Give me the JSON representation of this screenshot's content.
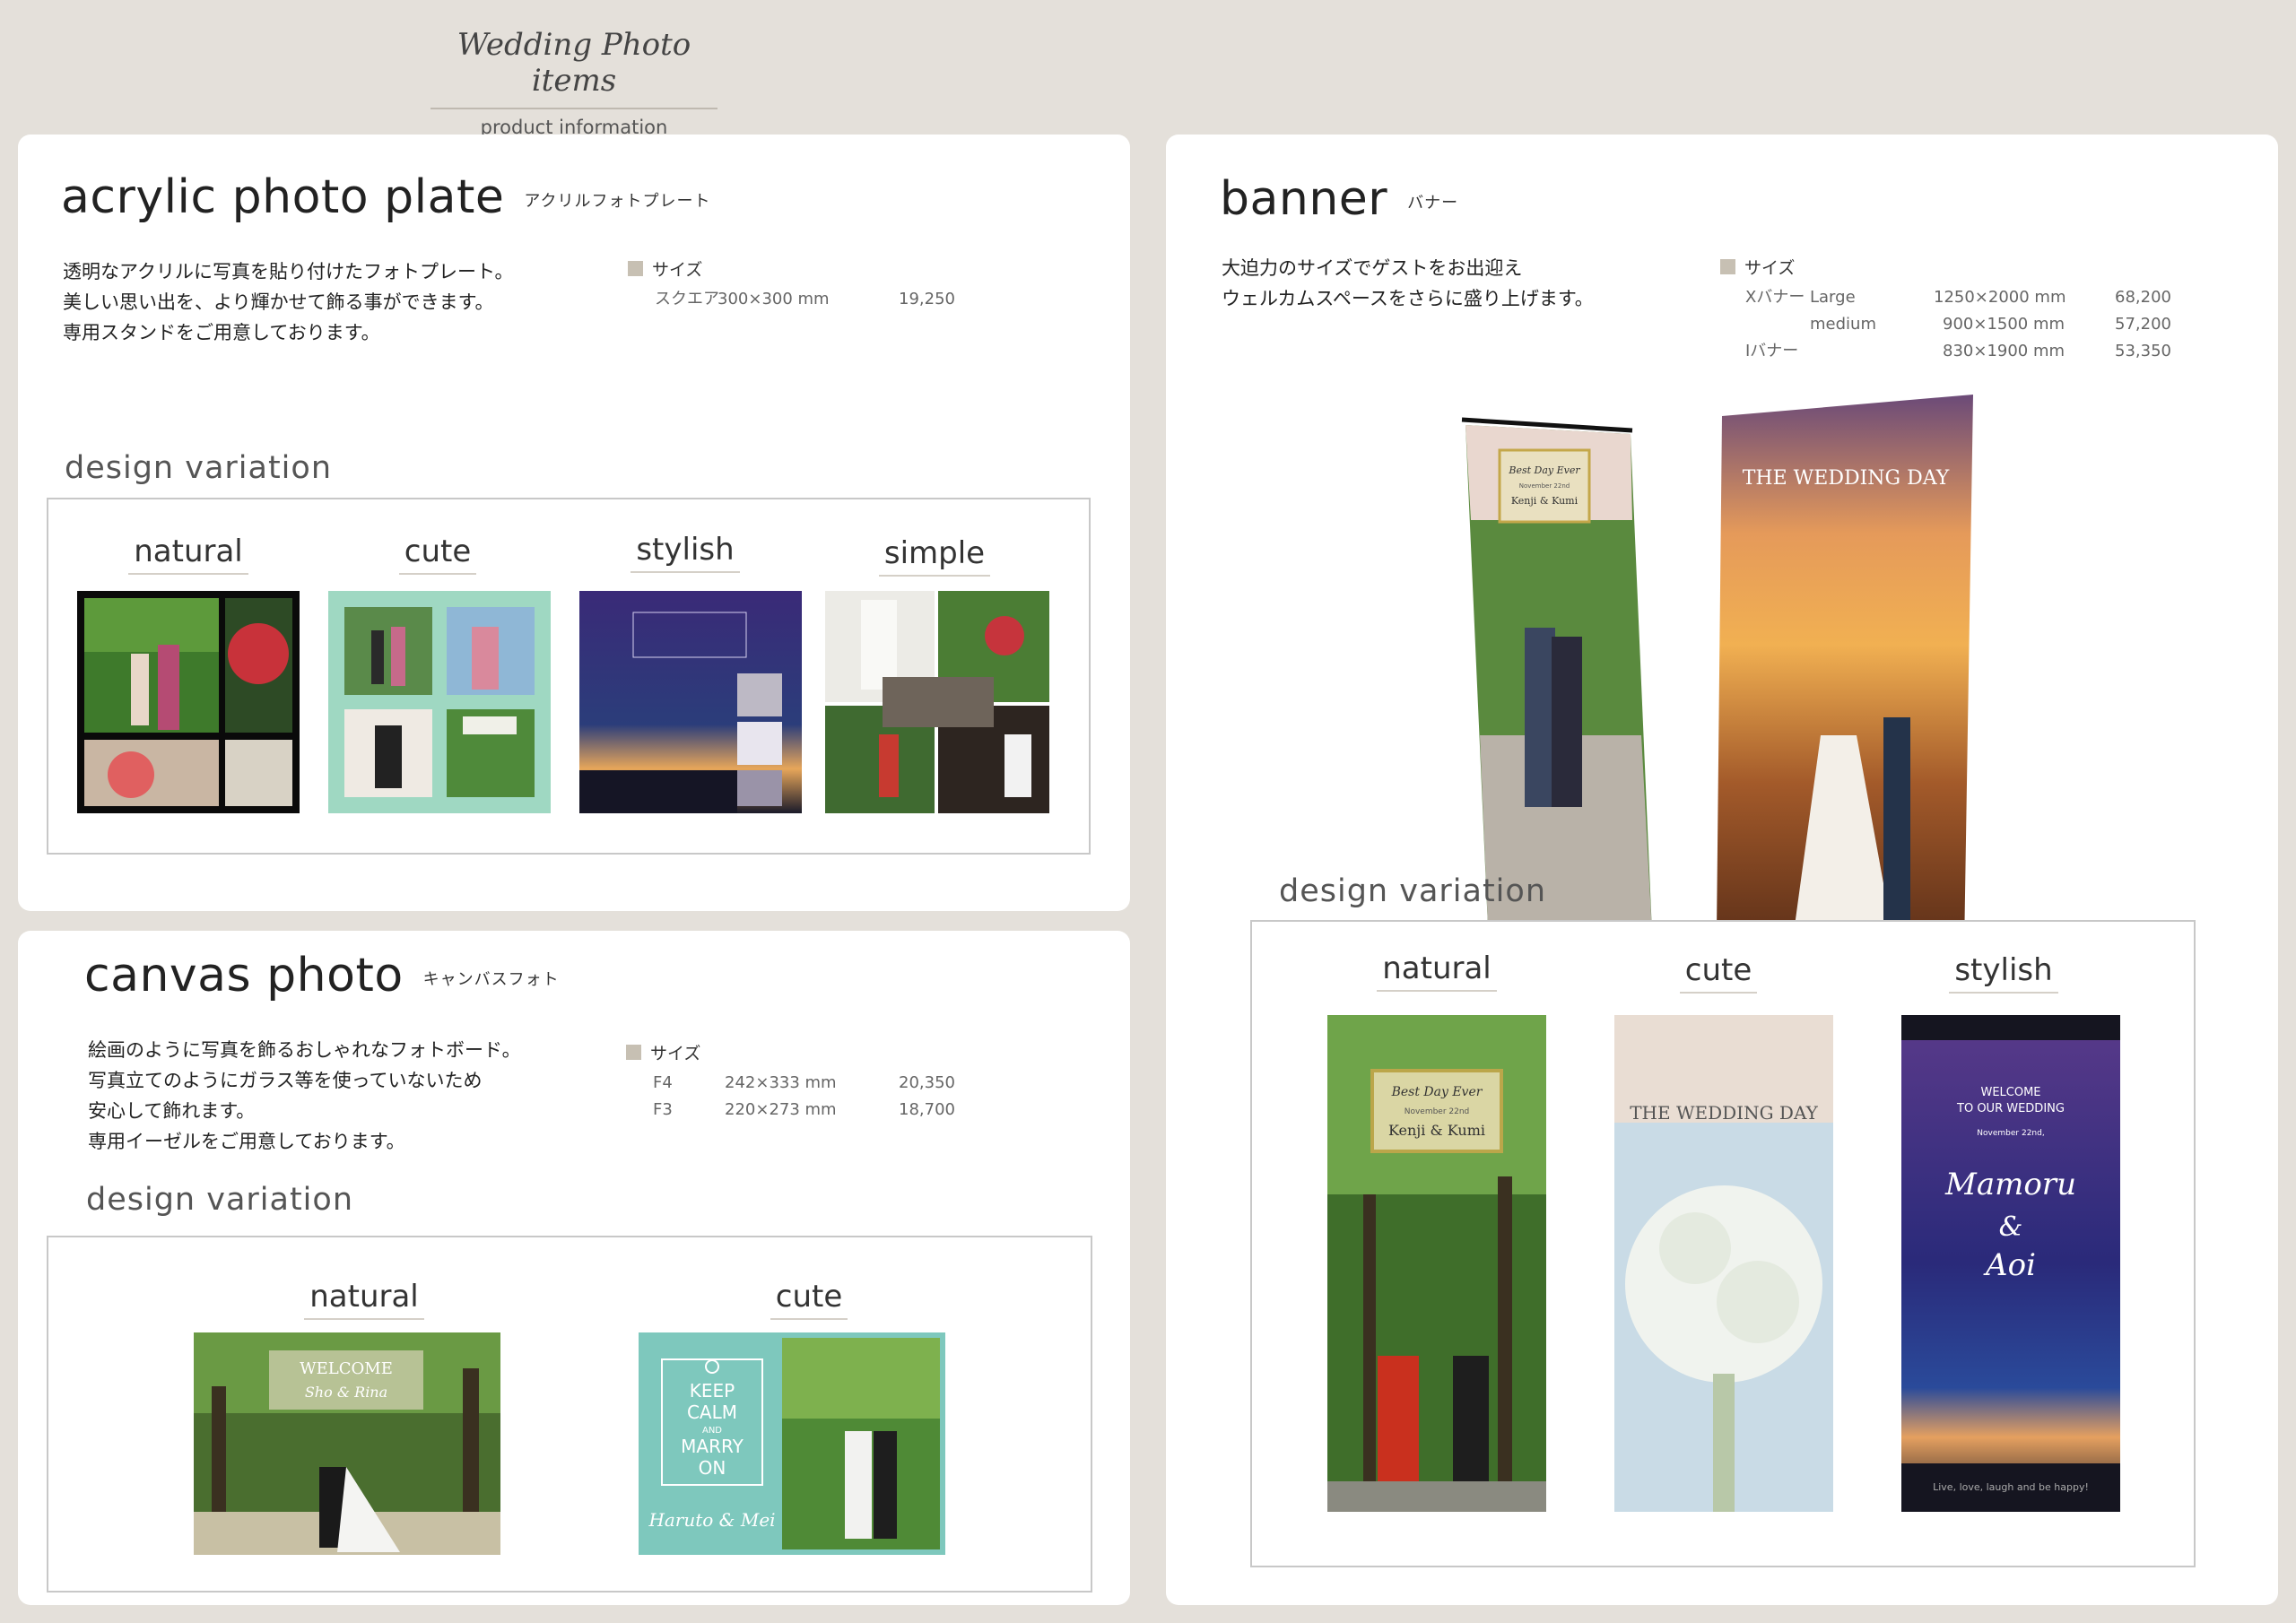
{
  "header": {
    "title": "Wedding Photo items",
    "subtitle": "product information"
  },
  "acrylic": {
    "title": "acrylic photo plate",
    "title_jp": "アクリルフォトプレート",
    "desc": [
      "透明なアクリルに写真を貼り付けたフォトプレート。",
      "美しい思い出を、より輝かせて飾る事ができます。",
      "専用スタンドをご用意しております。"
    ],
    "size_label": "サイズ",
    "sizes": [
      {
        "name": "スクエア",
        "dim": "300×300 mm",
        "price": "19,250"
      }
    ],
    "design_variation": "design variation",
    "variations": [
      "natural",
      "cute",
      "stylish",
      "simple"
    ]
  },
  "canvas": {
    "title": "canvas photo",
    "title_jp": "キャンバスフォト",
    "desc": [
      "絵画のように写真を飾るおしゃれなフォトボード。",
      "写真立てのようにガラス等を使っていないため",
      "安心して飾れます。",
      "専用イーゼルをご用意しております。"
    ],
    "size_label": "サイズ",
    "sizes": [
      {
        "name": "F4",
        "dim": "242×333 mm",
        "price": "20,350"
      },
      {
        "name": "F3",
        "dim": "220×273 mm",
        "price": "18,700"
      }
    ],
    "design_variation": "design variation",
    "variations": [
      "natural",
      "cute"
    ],
    "cute_card": {
      "text": [
        "KEEP",
        "CALM",
        "AND",
        "MARRY",
        "ON"
      ],
      "names": "Haruto & Mei"
    },
    "natural_card": {
      "text": "WELCOME",
      "names": "Sho & Rina"
    }
  },
  "banner": {
    "title": "banner",
    "title_jp": "バナー",
    "desc": [
      "大迫力のサイズでゲストをお出迎え",
      "ウェルカムスペースをさらに盛り上げます。"
    ],
    "size_label": "サイズ",
    "sizes": [
      {
        "type": "Xバナー",
        "name": "Large",
        "dim": "1250×2000 mm",
        "price": "68,200"
      },
      {
        "type": "",
        "name": "medium",
        "dim": "900×1500 mm",
        "price": "57,200"
      },
      {
        "type": "Iバナー",
        "name": "",
        "dim": "830×1900 mm",
        "price": "53,350"
      }
    ],
    "sample_left": {
      "line1": "Best Day Ever",
      "line2": "November 22nd",
      "names": "Kenji & Kumi"
    },
    "sample_right": {
      "title": "THE WEDDING DAY"
    },
    "design_variation": "design variation",
    "variations": [
      "natural",
      "cute",
      "stylish"
    ],
    "natural_card": {
      "line1": "Best Day Ever",
      "line2": "November 22nd",
      "names": "Kenji & Kumi"
    },
    "cute_card": {
      "title": "THE WEDDING DAY"
    },
    "stylish_card": {
      "line1": "WELCOME",
      "line2": "TO OUR WEDDING",
      "date": "November 22nd,",
      "names1": "Mamoru",
      "amp": "&",
      "names2": "Aoi",
      "footer": "Live, love, laugh and be happy!"
    }
  }
}
